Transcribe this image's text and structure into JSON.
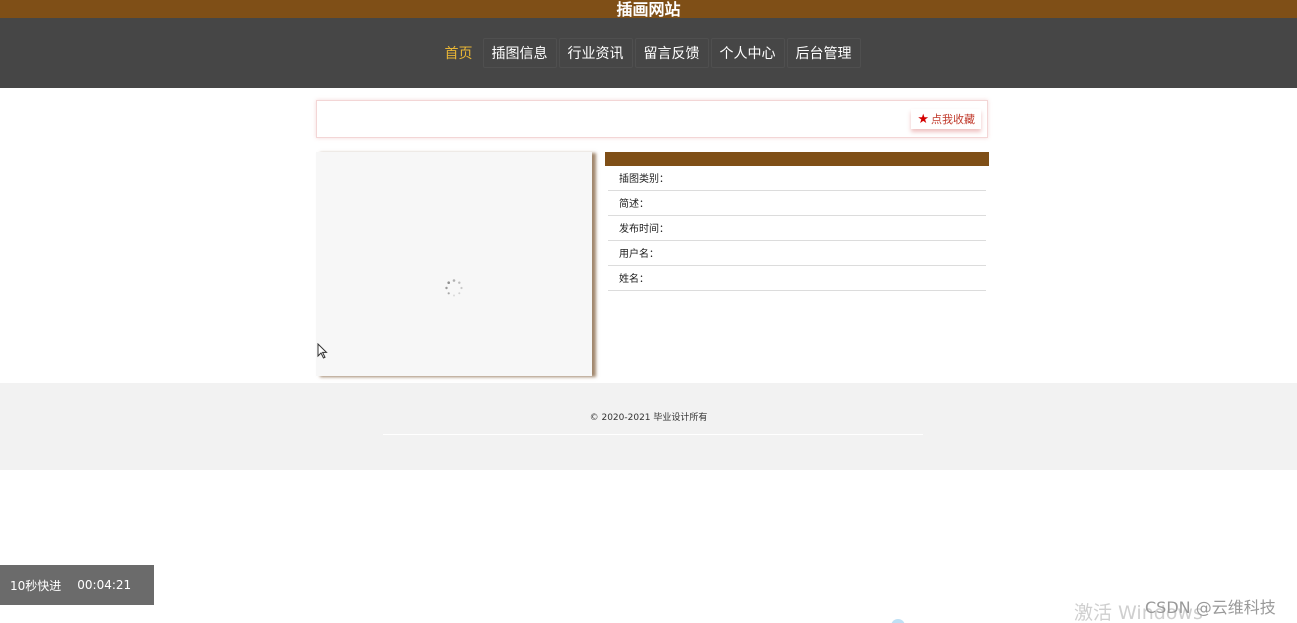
{
  "site": {
    "title": "插画网站"
  },
  "nav": {
    "items": [
      {
        "label": "首页",
        "active": true
      },
      {
        "label": "插图信息",
        "active": false
      },
      {
        "label": "行业资讯",
        "active": false
      },
      {
        "label": "留言反馈",
        "active": false
      },
      {
        "label": "个人中心",
        "active": false
      },
      {
        "label": "后台管理",
        "active": false
      }
    ]
  },
  "favorite": {
    "label": "点我收藏",
    "icon": "star-icon"
  },
  "details": {
    "fields": [
      {
        "label": "插图类别：",
        "value": ""
      },
      {
        "label": "简述：",
        "value": ""
      },
      {
        "label": "发布时间：",
        "value": ""
      },
      {
        "label": "用户名：",
        "value": ""
      },
      {
        "label": "姓名：",
        "value": ""
      }
    ]
  },
  "footer": {
    "copyright": "© 2020-2021 毕业设计所有"
  },
  "player": {
    "fast_forward_label": "10秒快进",
    "time": "00:04:21"
  },
  "overlay": {
    "activate_windows": "激活 Windows",
    "csdn_watermark": "CSDN @云维科技"
  },
  "colors": {
    "brand": "#7f4f17",
    "nav_bg": "#464646",
    "nav_active": "#e8b535",
    "favorite_red": "#d40000"
  }
}
